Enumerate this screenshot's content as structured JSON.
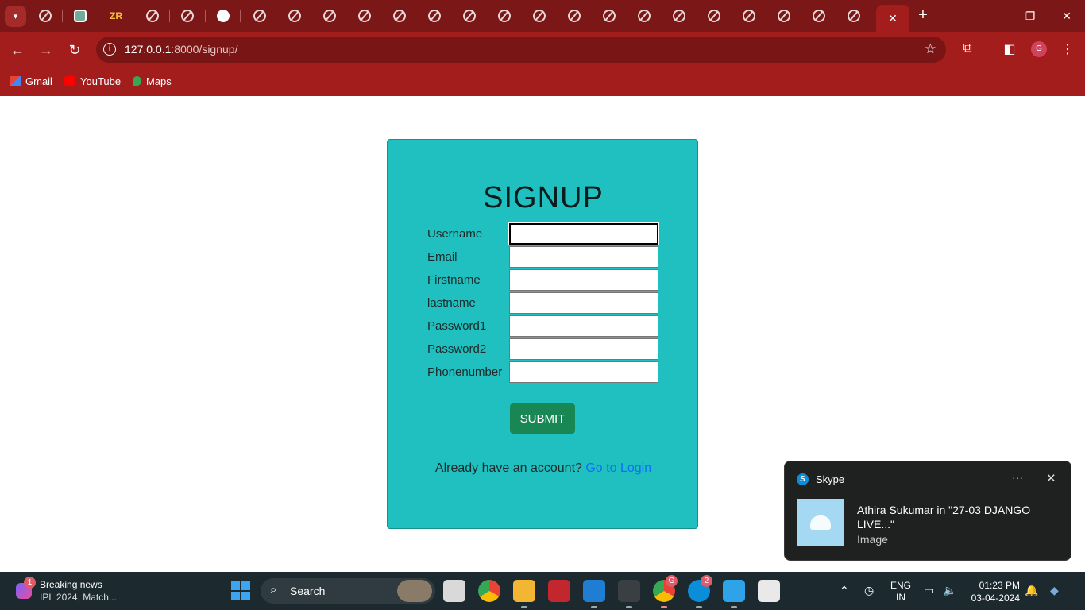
{
  "browser": {
    "url_host": "127.0.0.1",
    "url_path": ":8000/signup/",
    "profile_initial": "G",
    "bookmarks": [
      {
        "label": "Gmail",
        "icon": "gmail-icon"
      },
      {
        "label": "YouTube",
        "icon": "youtube-icon"
      },
      {
        "label": "Maps",
        "icon": "maps-icon"
      }
    ],
    "theme_color": "#a31d1d"
  },
  "page": {
    "heading": "SIGNUP",
    "fields": [
      {
        "label": "Username",
        "value": ""
      },
      {
        "label": "Email",
        "value": ""
      },
      {
        "label": "Firstname",
        "value": ""
      },
      {
        "label": "lastname",
        "value": ""
      },
      {
        "label": "Password1",
        "value": ""
      },
      {
        "label": "Password2",
        "value": ""
      },
      {
        "label": "Phonenumber",
        "value": ""
      }
    ],
    "submit_label": "SUBMIT",
    "login_prompt": "Already have an account?",
    "login_link": "Go to Login",
    "card_color": "#20c0c0",
    "button_color": "#198754"
  },
  "notification": {
    "app": "Skype",
    "title": "Athira Sukumar in \"27-03 DJANGO LIVE...\"",
    "subtitle": "Image"
  },
  "taskbar": {
    "news_count": "1",
    "news_title": "Breaking news",
    "news_subtitle": "IPL 2024, Match...",
    "search_label": "Search",
    "chrome_badge": "G",
    "skype_badge": "2",
    "lang_line1": "ENG",
    "lang_line2": "IN",
    "time": "01:23 PM",
    "date": "03-04-2024"
  }
}
